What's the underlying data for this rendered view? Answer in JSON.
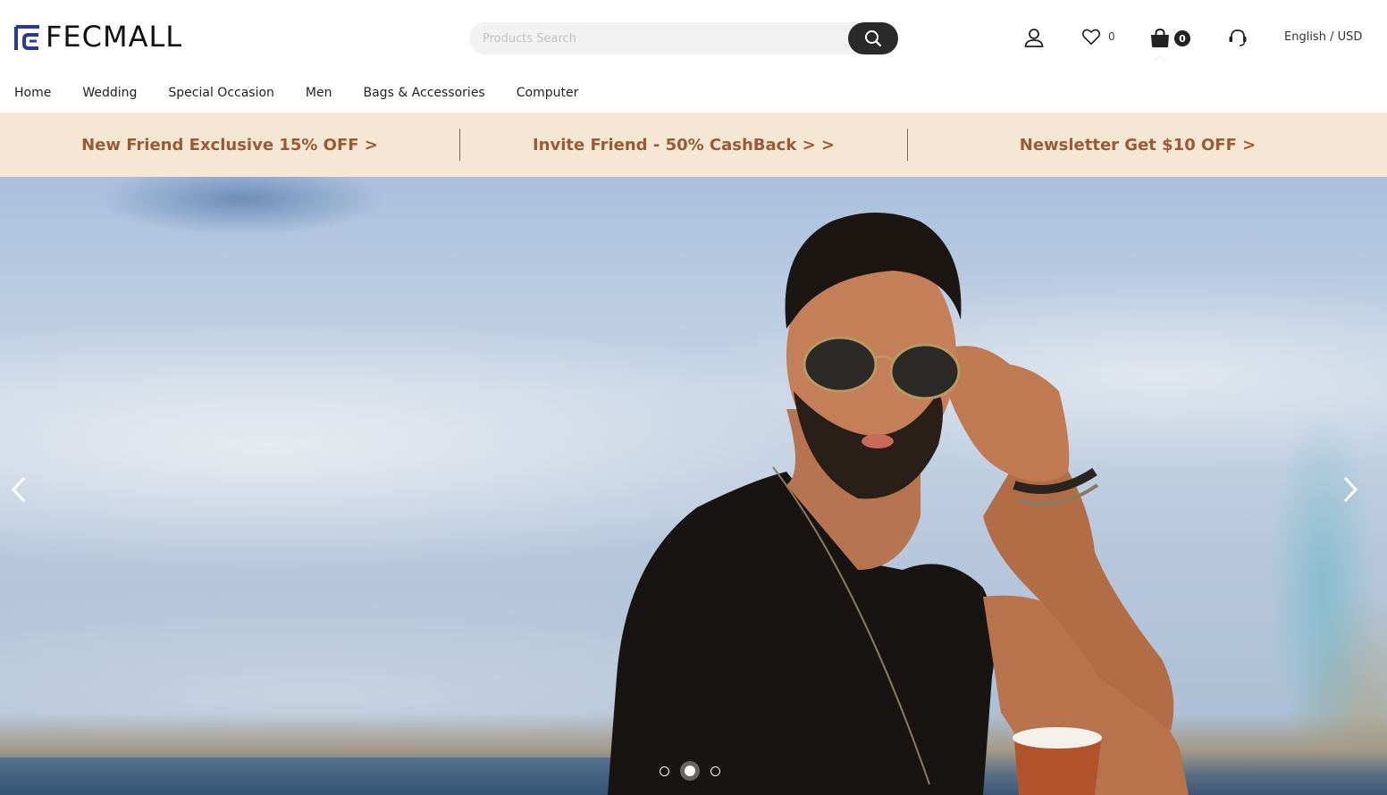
{
  "header": {
    "logo_text": "FECMALL",
    "search": {
      "placeholder": "Products Search"
    },
    "wishlist_count": "0",
    "cart_count": "0",
    "language_currency": "English / USD"
  },
  "nav": {
    "items": [
      {
        "label": "Home"
      },
      {
        "label": "Wedding"
      },
      {
        "label": "Special Occasion"
      },
      {
        "label": "Men"
      },
      {
        "label": "Bags & Accessories"
      },
      {
        "label": "Computer"
      }
    ]
  },
  "promo": {
    "items": [
      {
        "label": "New Friend Exclusive 15% OFF >"
      },
      {
        "label": "Invite Friend - 50% CashBack > >"
      },
      {
        "label": "Newsletter Get $10 OFF >"
      }
    ]
  },
  "hero": {
    "slide_count": 3,
    "active_slide": 2
  },
  "colors": {
    "brand_logo": "#2b3990",
    "promo_bg": "#f6e7d4",
    "promo_text": "#9a5a33",
    "search_button": "#2a2a2a"
  }
}
